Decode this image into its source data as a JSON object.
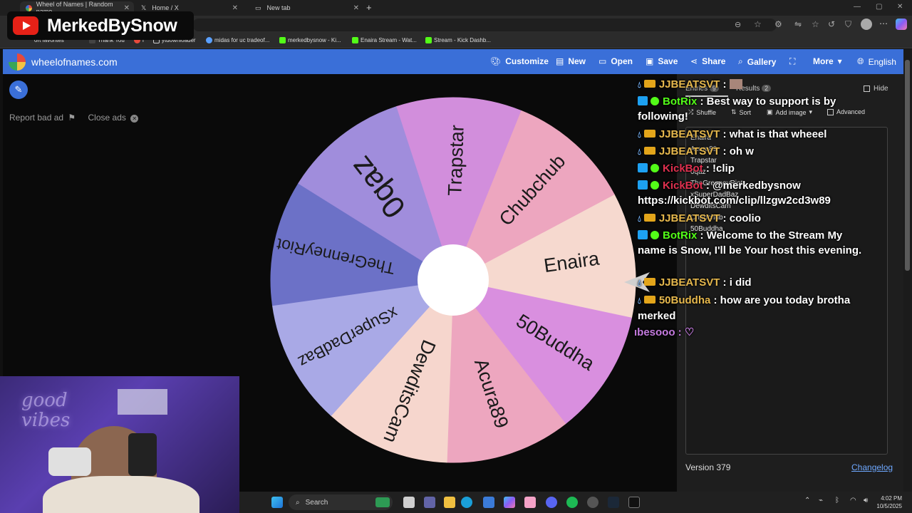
{
  "browser": {
    "tabs": [
      {
        "label": "Wheel of Names | Random name"
      },
      {
        "label": "Home / X"
      },
      {
        "label": "New tab"
      }
    ],
    "favorites": [
      {
        "label": "ort favorites",
        "color": "#8a8a8a"
      },
      {
        "label": "Thank You",
        "color": "#e0e0e0"
      },
      {
        "label": "i",
        "color": "#e64a3c"
      },
      {
        "label": "ytdownloader",
        "color": "#cfcfcf"
      },
      {
        "label": "midas for uc tradeof...",
        "color": "#5aa0ff"
      },
      {
        "label": "merkedbysnow - Ki...",
        "color": "#53fc18"
      },
      {
        "label": "Enaira Stream - Wat...",
        "color": "#53fc18"
      },
      {
        "label": "Stream - Kick Dashb...",
        "color": "#53fc18"
      }
    ]
  },
  "overlay": {
    "channel_name": "MerkedBySnow"
  },
  "site": {
    "name": "wheelofnames.com",
    "nav": {
      "customize": "Customize",
      "new": "New",
      "open": "Open",
      "save": "Save",
      "share": "Share",
      "gallery": "Gallery",
      "more": "More",
      "language": "English"
    },
    "report_ad": "Report bad ad",
    "close_ads": "Close ads"
  },
  "wheel": {
    "segments": [
      {
        "label": "Enaira",
        "color": "#f6d9cf"
      },
      {
        "label": "50Buddha",
        "color": "#d98fdf"
      },
      {
        "label": "Acura89",
        "color": "#eda6bf"
      },
      {
        "label": "DewditsCam",
        "color": "#f6d6cd"
      },
      {
        "label": "xSuperDadBaz",
        "color": "#a9a9e6"
      },
      {
        "label": "TheGrenneyRiot",
        "color": "#6c71c7"
      },
      {
        "label": "0qaz",
        "color": "#a08ddc"
      },
      {
        "label": "Trapstar",
        "color": "#d28edc"
      },
      {
        "label": "Chubchub",
        "color": "#eda6bf"
      }
    ]
  },
  "panel": {
    "entries_tab": "Entries",
    "entries_count": "9",
    "results_tab": "Results",
    "results_count": "2",
    "hide_label": "Hide",
    "shuffle": "Shuffle",
    "sort": "Sort",
    "add_image": "Add image",
    "advanced": "Advanced",
    "entries": [
      "Enaira",
      "Acura89",
      "Trapstar",
      "0qaz",
      "TheGrenneyRiot",
      "xSuperDadBaz",
      "DewditsCam",
      "Chubchub",
      "50Buddha"
    ],
    "version": "Version 379",
    "changelog": "Changelog"
  },
  "chat": [
    {
      "user": "JJBEATSVT",
      "user_color": "#e6b84d",
      "text": " : "
    },
    {
      "user": "BotRix",
      "user_color": "#53fc18",
      "text": " : Best way to support is by following!"
    },
    {
      "user": "JJBEATSVT",
      "user_color": "#e6b84d",
      "text": " : what is that wheeel"
    },
    {
      "user": "JJBEATSVT",
      "user_color": "#e6b84d",
      "text": " : oh w"
    },
    {
      "user": "KickBot",
      "user_color": "#e0304f",
      "text": " : !clip"
    },
    {
      "user": "KickBot",
      "user_color": "#e0304f",
      "text": " : @merkedbysnow https://kickbot.com/clip/llzgw2cd3w89"
    },
    {
      "user": "JJBEATSVT",
      "user_color": "#e6b84d",
      "text": " : coolio"
    },
    {
      "user": "BotRix",
      "user_color": "#53fc18",
      "text": " : Welcome to the Stream My name is Snow, I'll be Your host this evening."
    },
    {
      "user": "JJBEATSVT",
      "user_color": "#e6b84d",
      "text": " : i did"
    },
    {
      "user": "50Buddha",
      "user_color": "#e6b84d",
      "text": " : how are you today brotha merked"
    },
    {
      "user": "ıbesooo",
      "user_color": "#c57be0",
      "text": " : ♡"
    }
  ],
  "taskbar": {
    "search": "Search",
    "time": "4:02 PM",
    "date": "10/5/2025"
  },
  "webcam": {
    "neon_text": "good vibes"
  }
}
